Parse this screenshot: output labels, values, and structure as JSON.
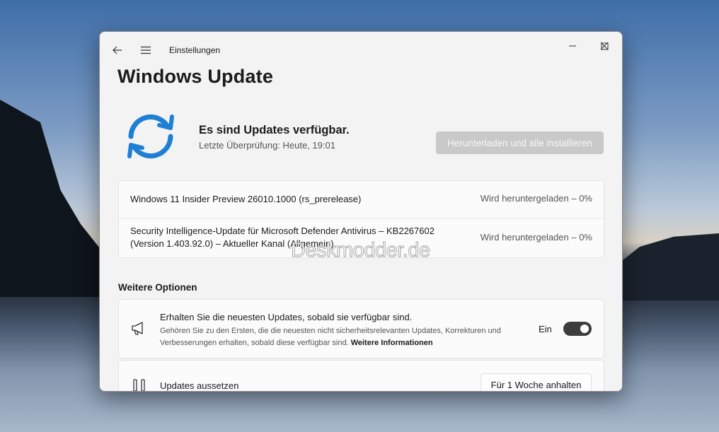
{
  "window": {
    "app_title": "Einstellungen"
  },
  "page": {
    "title": "Windows Update"
  },
  "status": {
    "icon": "sync-arrows-icon",
    "title": "Es sind Updates verfügbar.",
    "subtitle": "Letzte Überprüfung: Heute, 19:01",
    "install_button": "Herunterladen und alle installieren"
  },
  "updates": [
    {
      "name_line1": "Windows 11 Insider Preview 26010.1000 (rs_prerelease)",
      "name_line2": "",
      "status": "Wird heruntergeladen – 0%"
    },
    {
      "name_line1": "Security Intelligence-Update für Microsoft Defender Antivirus – KB2267602",
      "name_line2": "(Version 1.403.92.0) – Aktueller Kanal (Allgemein)",
      "status": "Wird heruntergeladen – 0%"
    }
  ],
  "watermark": "Deskmodder.de",
  "more_options": {
    "heading": "Weitere Optionen",
    "latest_updates": {
      "icon": "megaphone-icon",
      "title": "Erhalten Sie die neuesten Updates, sobald sie verfügbar sind.",
      "description": "Gehören Sie zu den Ersten, die die neuesten nicht sicherheitsrelevanten Updates, Korrekturen und Verbesserungen erhalten, sobald diese verfügbar sind.",
      "link": "Weitere Informationen",
      "toggle_label": "Ein",
      "toggle_on": true
    },
    "pause": {
      "icon": "pause-icon",
      "title": "Updates aussetzen",
      "button": "Für 1 Woche anhalten"
    }
  },
  "colors": {
    "accent": "#1f7fd4",
    "toggle_on": "#3d3d3d",
    "disabled_button": "#c9c9c9"
  }
}
